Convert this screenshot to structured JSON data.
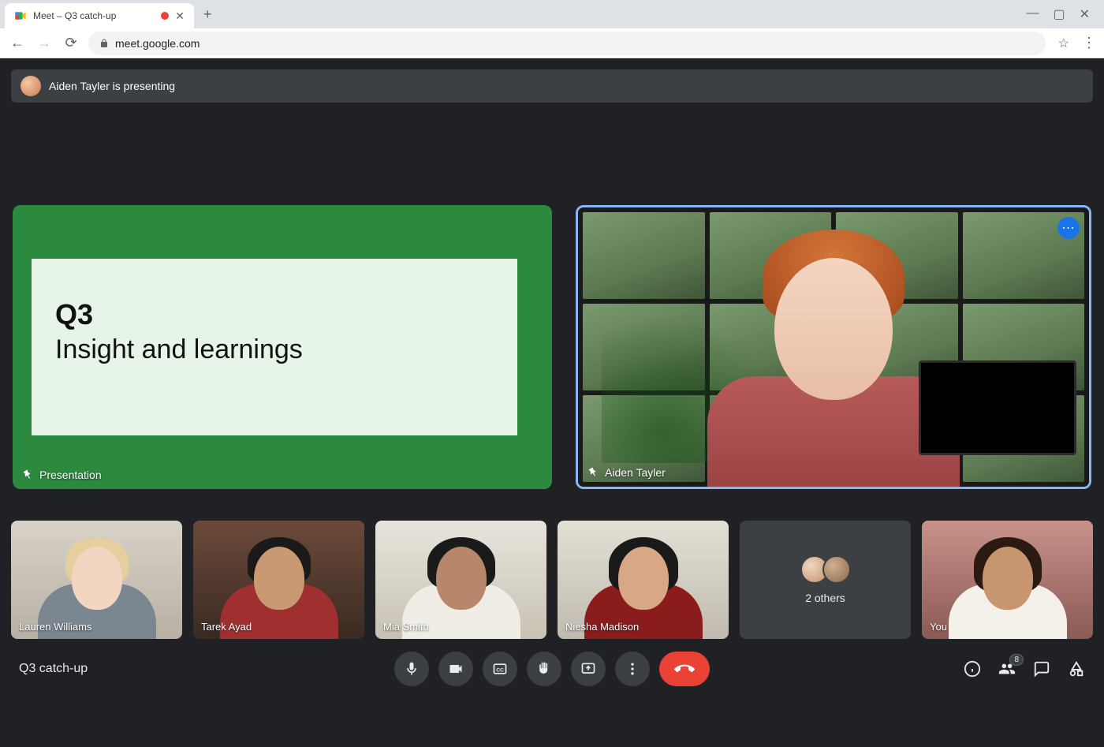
{
  "browser": {
    "tab_title": "Meet – Q3 catch-up",
    "url": "meet.google.com"
  },
  "app": {
    "presenting_banner": "Aiden Tayler is presenting",
    "main_tiles": {
      "presentation": {
        "label": "Presentation",
        "slide_title": "Q3",
        "slide_subtitle": "Insight and learnings"
      },
      "speaker": {
        "name": "Aiden Tayler"
      }
    },
    "thumbnails": [
      {
        "name": "Lauren Williams"
      },
      {
        "name": "Tarek Ayad"
      },
      {
        "name": "Mia Smith"
      },
      {
        "name": "Niesha Madison"
      },
      {
        "name_others": "2 others"
      },
      {
        "name": "You"
      }
    ],
    "meeting_name": "Q3 catch-up",
    "participants_count": "8"
  }
}
